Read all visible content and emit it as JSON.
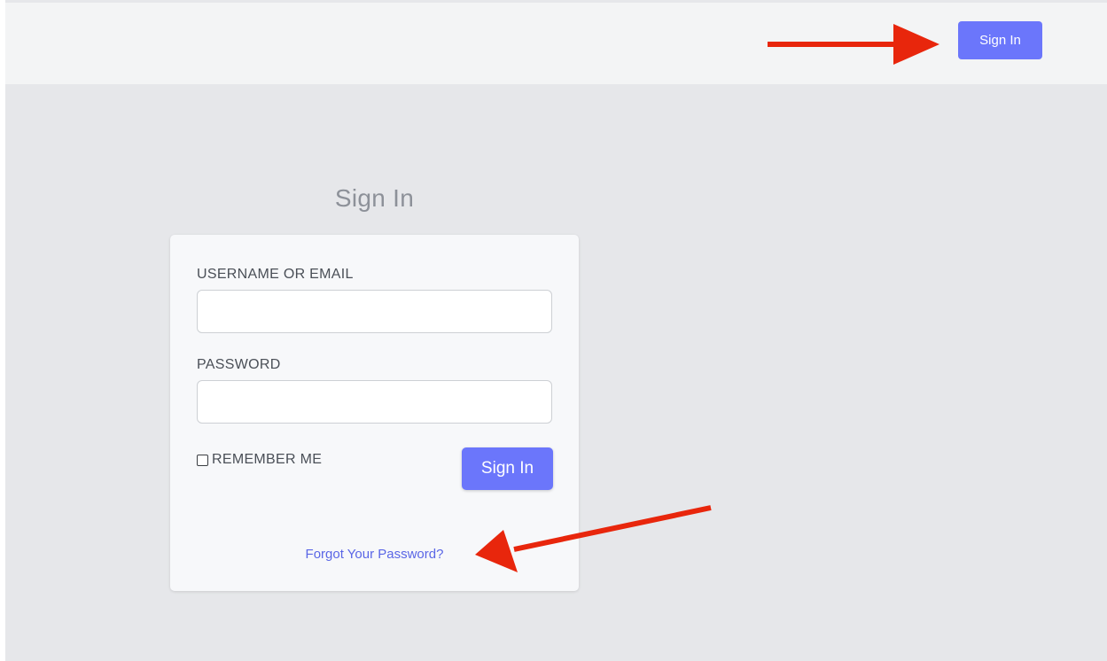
{
  "header": {
    "signin_label": "Sign In"
  },
  "page": {
    "title": "Sign In"
  },
  "form": {
    "username_label": "USERNAME OR EMAIL",
    "username_value": "",
    "password_label": "PASSWORD",
    "password_value": "",
    "remember_label": "REMEMBER ME",
    "remember_checked": false,
    "signin_label": "Sign In",
    "forgot_label": "Forgot Your Password?"
  },
  "colors": {
    "accent": "#6b76fb",
    "link": "#5a66e6",
    "annotation_arrow": "#e8260c",
    "background": "#e6e7ea",
    "header_background": "#f3f4f5"
  },
  "icons": {
    "checkbox": "checkbox-icon",
    "arrow": "arrow-icon"
  }
}
